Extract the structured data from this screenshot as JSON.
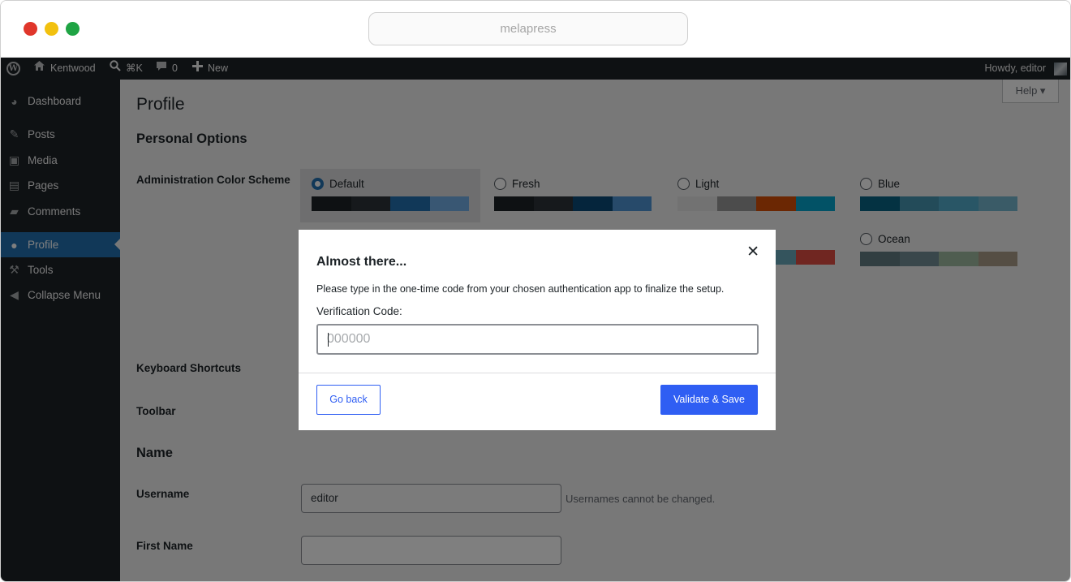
{
  "browser": {
    "url": "melapress"
  },
  "adminbar": {
    "site_name": "Kentwood",
    "search_shortcut": "⌘K",
    "comments_count": "0",
    "new_label": "New",
    "howdy": "Howdy, editor"
  },
  "sidebar": {
    "items": [
      {
        "label": "Dashboard",
        "icon": "dashboard-icon"
      },
      {
        "label": "Posts",
        "icon": "pin-icon"
      },
      {
        "label": "Media",
        "icon": "media-icon"
      },
      {
        "label": "Pages",
        "icon": "pages-icon"
      },
      {
        "label": "Comments",
        "icon": "comment-icon"
      },
      {
        "label": "Profile",
        "icon": "user-icon"
      },
      {
        "label": "Tools",
        "icon": "wrench-icon"
      },
      {
        "label": "Collapse Menu",
        "icon": "collapse-icon"
      }
    ],
    "current": "Profile"
  },
  "content": {
    "help_label": "Help ▾",
    "page_title": "Profile",
    "personal_options": "Personal Options",
    "color_scheme_label": "Administration Color Scheme",
    "keyboard_shortcuts_label": "Keyboard Shortcuts",
    "toolbar_label": "Toolbar",
    "name_heading": "Name",
    "username_label": "Username",
    "username_value": "editor",
    "username_help": "Usernames cannot be changed.",
    "first_name_label": "First Name",
    "first_name_value": ""
  },
  "color_schemes": [
    {
      "name": "Default",
      "selected": true,
      "colors": [
        "#1d2327",
        "#2c3338",
        "#2271b1",
        "#72aee6"
      ]
    },
    {
      "name": "Fresh",
      "selected": false,
      "colors": [
        "#1d2327",
        "#2c3338",
        "#0a4b78",
        "#4f94d4"
      ]
    },
    {
      "name": "Light",
      "selected": false,
      "colors": [
        "#e5e5e5",
        "#999999",
        "#d64e07",
        "#04a4cc"
      ]
    },
    {
      "name": "Blue",
      "selected": false,
      "colors": [
        "#096484",
        "#4796b3",
        "#52accc",
        "#74b6ce"
      ]
    },
    {
      "name": "Ocean",
      "selected": false,
      "colors": [
        "#627c83",
        "#738e96",
        "#9ebaa0",
        "#aa9d88"
      ]
    }
  ],
  "modal": {
    "title": "Almost there...",
    "description": "Please type in the one-time code from your chosen authentication app to finalize the setup.",
    "code_label": "Verification Code:",
    "code_placeholder": "000000",
    "back_label": "Go back",
    "validate_label": "Validate & Save",
    "close_icon": "close-icon"
  },
  "colors": {
    "accent": "#2271b1",
    "primary_button": "#2f5ef3",
    "admin_dark": "#1d2327"
  }
}
